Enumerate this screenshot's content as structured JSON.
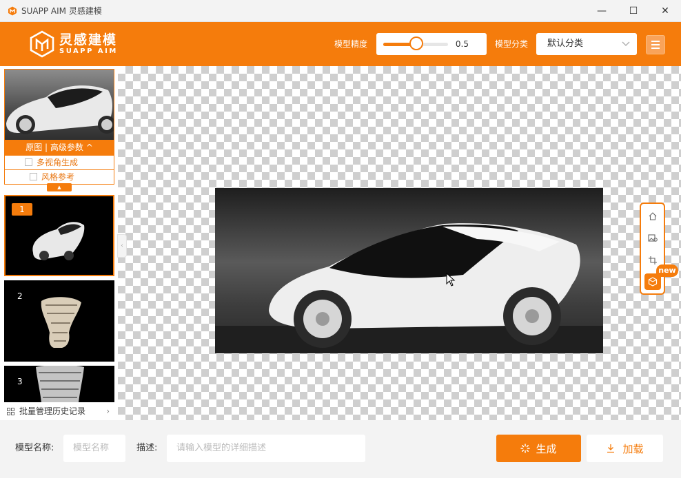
{
  "window": {
    "title": "SUAPP AIM 灵感建模",
    "minimize": "—",
    "maximize": "☐",
    "close": "✕"
  },
  "header": {
    "logo_cn": "灵感建模",
    "logo_en": "SUAPP AIM",
    "precision_label": "模型精度",
    "precision_value": "0.5",
    "precision_fraction": 0.5,
    "category_label": "模型分类",
    "category_value": "默认分类",
    "accent_color": "#f57c0c"
  },
  "left_panel": {
    "original_bar_label": "原图 | 高级参数 ^",
    "option_multiview": "多视角生成",
    "option_style": "风格参考",
    "collapse_icon": "▲",
    "history": [
      {
        "num": "1",
        "selected": true
      },
      {
        "num": "2",
        "selected": false
      },
      {
        "num": "3",
        "selected": false
      }
    ],
    "batch_label": "批量管理历史记录",
    "batch_chevron": "›"
  },
  "sidebar_toggle": "‹",
  "tools": {
    "items": [
      "home-icon",
      "image-compare-icon",
      "crop-icon",
      "cube-icon"
    ],
    "new_badge": "new"
  },
  "bottom": {
    "name_label": "模型名称:",
    "name_placeholder": "模型名称",
    "desc_label": "描述:",
    "desc_placeholder": "请输入模型的详细描述",
    "generate_label": "生成",
    "load_label": "加载"
  }
}
